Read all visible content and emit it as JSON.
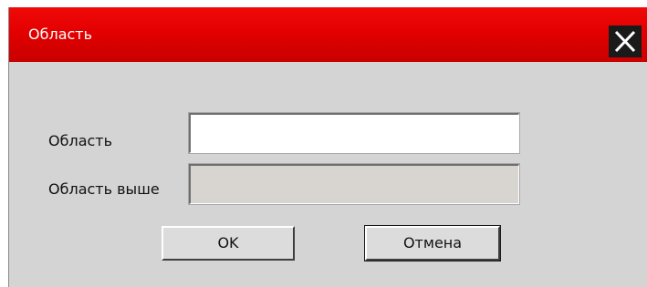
{
  "window": {
    "title": "Область",
    "close_icon": "close-icon"
  },
  "form": {
    "area_label": "Область",
    "area_value": "",
    "parent_area_label": "Область выше",
    "parent_area_value": ""
  },
  "buttons": {
    "ok_label": "OK",
    "cancel_label": "Отмена"
  },
  "colors": {
    "titlebar": "#e30000",
    "title_text": "#ffffff",
    "dialog_bg": "#d4d4d4",
    "close_bg": "#1a1a1a"
  }
}
